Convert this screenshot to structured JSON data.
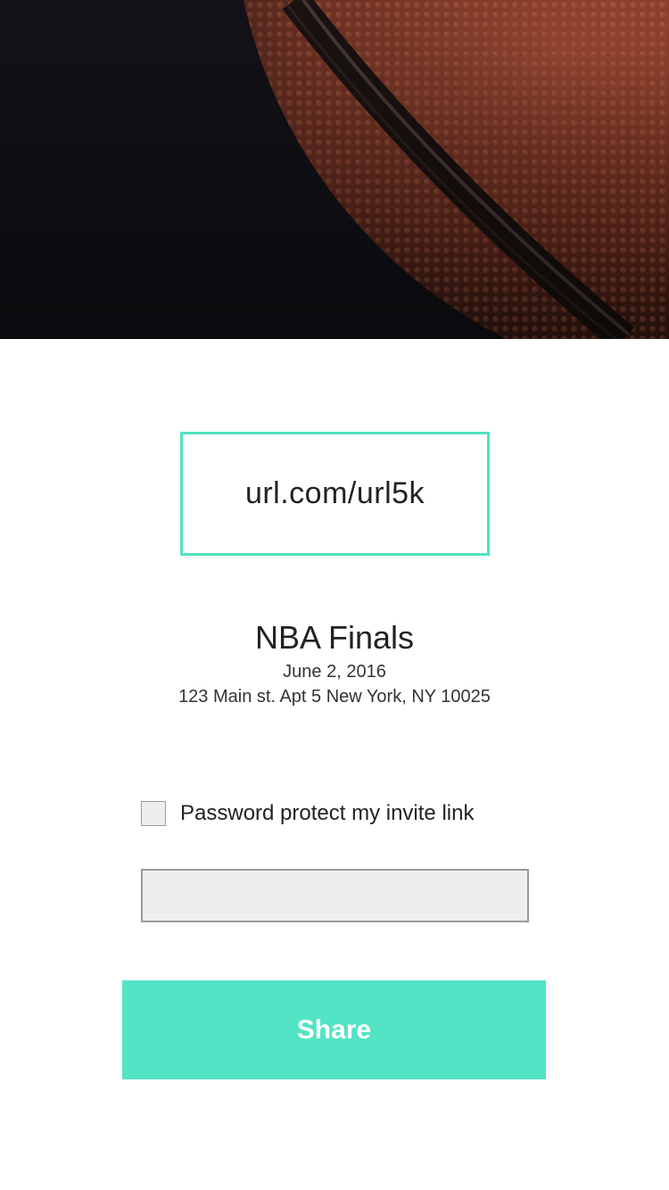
{
  "hero": {
    "image_subject": "basketball-closeup"
  },
  "invite": {
    "url": "url.com/url5k"
  },
  "event": {
    "title": "NBA Finals",
    "date": "June 2, 2016",
    "address": "123 Main st. Apt 5 New York, NY 10025"
  },
  "password_protect": {
    "label": "Password protect my invite link",
    "checked": false
  },
  "password_field": {
    "value": "",
    "placeholder": ""
  },
  "share_button": {
    "label": "Share"
  },
  "colors": {
    "accent": "#52e4c4",
    "url_border": "#4fe3c3",
    "text": "#222222",
    "field_background": "#eeeeee",
    "field_border": "#9a9a9a"
  }
}
